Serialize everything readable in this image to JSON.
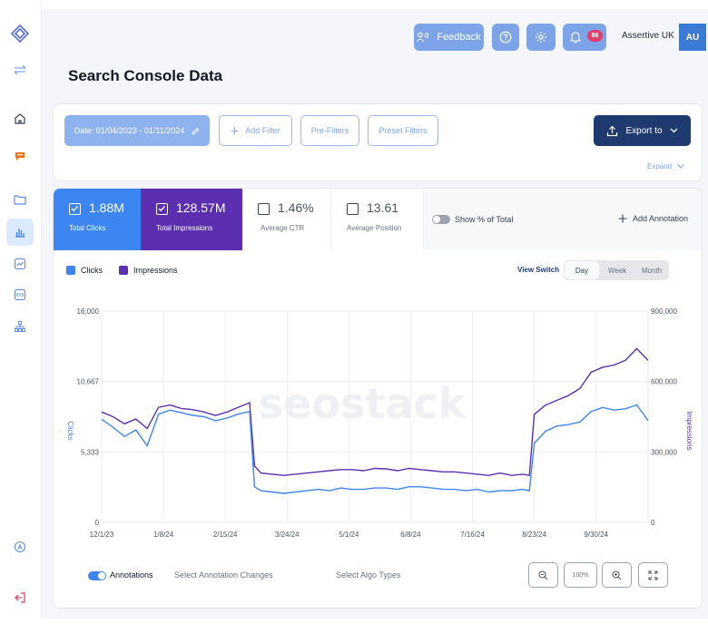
{
  "topbar": {
    "feedback_label": "Feedback",
    "notification_count": "86",
    "account_name": "Assertive UK",
    "avatar_initials": "AU"
  },
  "page": {
    "title": "Search Console Data"
  },
  "filters": {
    "date_label": "Date: 01/04/2023 - 01/11/2024",
    "add_filter": "Add Filter",
    "pre_filters": "Pre-Filters",
    "preset_filters": "Preset Filters",
    "export_label": "Export to",
    "expand_label": "Expand"
  },
  "metrics": {
    "clicks": {
      "value": "1.88M",
      "label": "Total Clicks"
    },
    "impressions": {
      "value": "128.57M",
      "label": "Total Impressions"
    },
    "ctr": {
      "value": "1.46%",
      "label": "Average CTR"
    },
    "position": {
      "value": "13.61",
      "label": "Average Position"
    },
    "show_percent_label": "Show % of Total",
    "add_annotation_label": "Add Annotation"
  },
  "view": {
    "label": "View Switch",
    "options": [
      "Day",
      "Week",
      "Month"
    ],
    "selected": "Day"
  },
  "footer": {
    "annotations_label": "Annotations",
    "annotation_changes": "Select Annotation Changes",
    "algo_types": "Select Algo Types",
    "zoom_reset_label": "100%"
  },
  "colors": {
    "clicks": "#3d85f0",
    "impressions": "#5b2fb0"
  },
  "chart_data": {
    "type": "line",
    "legend_placement": "top-left",
    "grid": true,
    "x_ticks": [
      "12/1/23",
      "1/8/24",
      "2/15/24",
      "3/24/24",
      "5/1/24",
      "6/8/24",
      "7/16/24",
      "8/23/24",
      "9/30/24"
    ],
    "ylabel": "Clicks",
    "y2label": "Impressions",
    "ylim": [
      0,
      16000
    ],
    "y2lim": [
      0,
      900000
    ],
    "y_ticks": [
      "0",
      "5,333",
      "10,667",
      "16,000"
    ],
    "y2_ticks": [
      "0",
      "300,000",
      "600,000",
      "900,000"
    ],
    "watermark": "seostack",
    "series": [
      {
        "name": "Clicks",
        "axis": "left",
        "x": [
          "12/1/23",
          "12/8/23",
          "12/15/23",
          "12/22/23",
          "12/29/23",
          "1/5/24",
          "1/12/24",
          "1/19/24",
          "1/26/24",
          "2/2/24",
          "2/9/24",
          "2/16/24",
          "2/23/24",
          "3/1/24",
          "3/4/24",
          "3/8/24",
          "3/15/24",
          "3/22/24",
          "3/29/24",
          "4/5/24",
          "4/12/24",
          "4/19/24",
          "4/26/24",
          "5/3/24",
          "5/10/24",
          "5/17/24",
          "5/24/24",
          "5/31/24",
          "6/7/24",
          "6/14/24",
          "6/21/24",
          "6/28/24",
          "7/5/24",
          "7/12/24",
          "7/19/24",
          "7/26/24",
          "8/2/24",
          "8/9/24",
          "8/16/24",
          "8/20/24",
          "8/23/24",
          "8/30/24",
          "9/6/24",
          "9/13/24",
          "9/20/24",
          "9/27/24",
          "10/4/24",
          "10/11/24",
          "10/18/24",
          "10/25/24",
          "11/1/24"
        ],
        "values": [
          7800,
          7200,
          6500,
          7000,
          5800,
          8200,
          8500,
          8300,
          8100,
          8000,
          7700,
          7900,
          8200,
          8400,
          2700,
          2400,
          2300,
          2200,
          2300,
          2400,
          2500,
          2400,
          2600,
          2500,
          2500,
          2600,
          2600,
          2500,
          2700,
          2700,
          2600,
          2500,
          2500,
          2400,
          2500,
          2300,
          2400,
          2400,
          2500,
          2400,
          6000,
          6900,
          7300,
          7400,
          7600,
          8400,
          8700,
          8500,
          8600,
          8900,
          7700
        ]
      },
      {
        "name": "Impressions",
        "axis": "right",
        "x": [
          "12/1/23",
          "12/8/23",
          "12/15/23",
          "12/22/23",
          "12/29/23",
          "1/5/24",
          "1/12/24",
          "1/19/24",
          "1/26/24",
          "2/2/24",
          "2/9/24",
          "2/16/24",
          "2/23/24",
          "3/1/24",
          "3/4/24",
          "3/8/24",
          "3/15/24",
          "3/22/24",
          "3/29/24",
          "4/5/24",
          "4/12/24",
          "4/19/24",
          "4/26/24",
          "5/3/24",
          "5/10/24",
          "5/17/24",
          "5/24/24",
          "5/31/24",
          "6/7/24",
          "6/14/24",
          "6/21/24",
          "6/28/24",
          "7/5/24",
          "7/12/24",
          "7/19/24",
          "7/26/24",
          "8/2/24",
          "8/9/24",
          "8/16/24",
          "8/20/24",
          "8/23/24",
          "8/30/24",
          "9/6/24",
          "9/13/24",
          "9/20/24",
          "9/27/24",
          "10/4/24",
          "10/11/24",
          "10/18/24",
          "10/25/24",
          "11/1/24"
        ],
        "values": [
          470000,
          450000,
          420000,
          440000,
          400000,
          490000,
          500000,
          485000,
          480000,
          470000,
          455000,
          470000,
          490000,
          510000,
          240000,
          210000,
          205000,
          200000,
          205000,
          210000,
          215000,
          220000,
          225000,
          225000,
          220000,
          230000,
          228000,
          220000,
          230000,
          225000,
          220000,
          215000,
          215000,
          210000,
          205000,
          200000,
          210000,
          200000,
          205000,
          200000,
          460000,
          500000,
          520000,
          540000,
          570000,
          640000,
          660000,
          670000,
          690000,
          740000,
          690000
        ]
      }
    ]
  }
}
